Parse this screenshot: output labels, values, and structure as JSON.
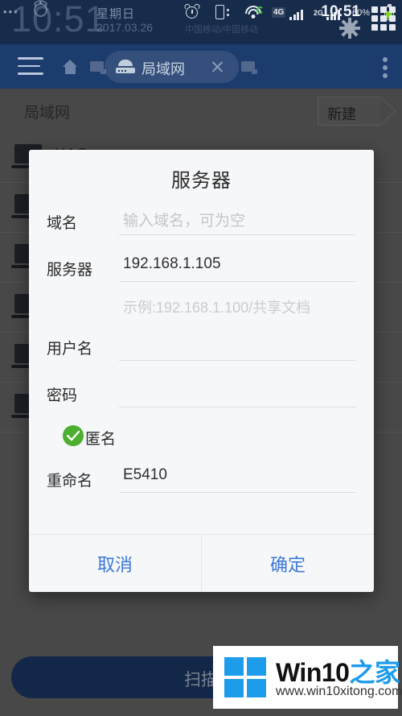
{
  "statusbar": {
    "dots": "•••",
    "clock_large": "10:51",
    "weekday": "星期日",
    "date": "2017.03.26",
    "carrier": "中国移动/中国移动",
    "icons": {
      "alarm": "alarm-icon",
      "vibrate": "vibrate-icon",
      "wifi": "wifi-icon",
      "net_4g": "4G",
      "net_2g": "2G",
      "battery_percent": "60%"
    },
    "time": "10:51",
    "battery_color": "#7ed321",
    "wifi_sync_color": "#3fc23f",
    "background": "#172b4a"
  },
  "navbar": {
    "menu_icon": "hamburger-icon",
    "home_icon": "home-icon",
    "tab": {
      "icon": "router-icon",
      "label": "局域网",
      "close_icon": "close-icon"
    },
    "overflow_icon": "more-vertical-icon",
    "background": "#1d3c6e"
  },
  "content": {
    "header_title": "局域网",
    "new_button_label": "新建",
    "devices": [
      {
        "name": "XAO",
        "icon": "laptop-icon"
      },
      {
        "name": "",
        "icon": "laptop-icon"
      },
      {
        "name": "",
        "icon": "laptop-icon"
      },
      {
        "name": "",
        "icon": "laptop-icon"
      },
      {
        "name": "",
        "icon": "laptop-icon"
      },
      {
        "name": "",
        "icon": "laptop-icon"
      }
    ],
    "scan_button_label": "扫描",
    "scan_button_color": "#1d3c6e"
  },
  "dialog": {
    "title": "服务器",
    "fields": [
      {
        "label": "域名",
        "value": "",
        "placeholder": "输入域名，可为空"
      },
      {
        "label": "服务器",
        "value": "192.168.1.105",
        "placeholder": ""
      },
      {
        "label": "用户名",
        "value": "",
        "placeholder": ""
      },
      {
        "label": "密码",
        "value": "",
        "placeholder": ""
      }
    ],
    "server_hint": "示例:192.168.1.100/共享文档",
    "anonymous": {
      "label": "匿名",
      "checked": true,
      "color": "#4caf2f"
    },
    "rename": {
      "label": "重命名",
      "value": "E5410"
    },
    "cancel_label": "取消",
    "confirm_label": "确定",
    "button_color": "#3b78d8",
    "background": "#f6f7f9"
  },
  "watermark": {
    "brand_en": "Win10",
    "brand_cn": "之家",
    "url": "www.win10xitong.com",
    "logo_color": "#1e9cec"
  }
}
